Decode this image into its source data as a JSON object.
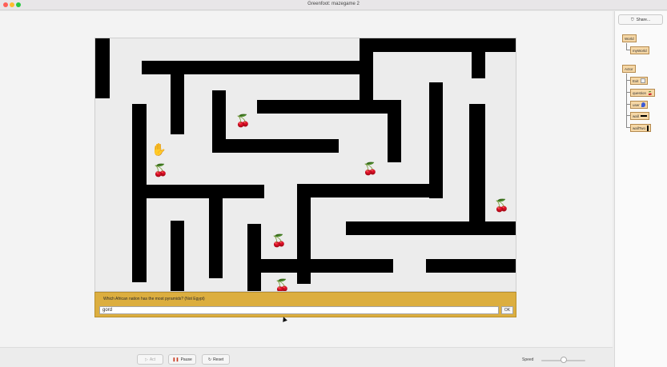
{
  "window": {
    "title": "Greenfoot: mazegame 2"
  },
  "toolbar": {
    "act_label": "Act",
    "pause_label": "Pause",
    "reset_label": "Reset",
    "speed_label": "Speed",
    "speed_value": 0.45
  },
  "ask": {
    "question": "Which African nation has the most pyramids? (Not Egypt)",
    "answer": "gord",
    "ok_label": "OK"
  },
  "sidebar": {
    "share_label": "Share...",
    "world_class": "World",
    "world_sub": "myWorld",
    "actor_class": "Actor",
    "actors": [
      "Exit",
      "question",
      "user",
      "wall",
      "wallTwo"
    ]
  }
}
